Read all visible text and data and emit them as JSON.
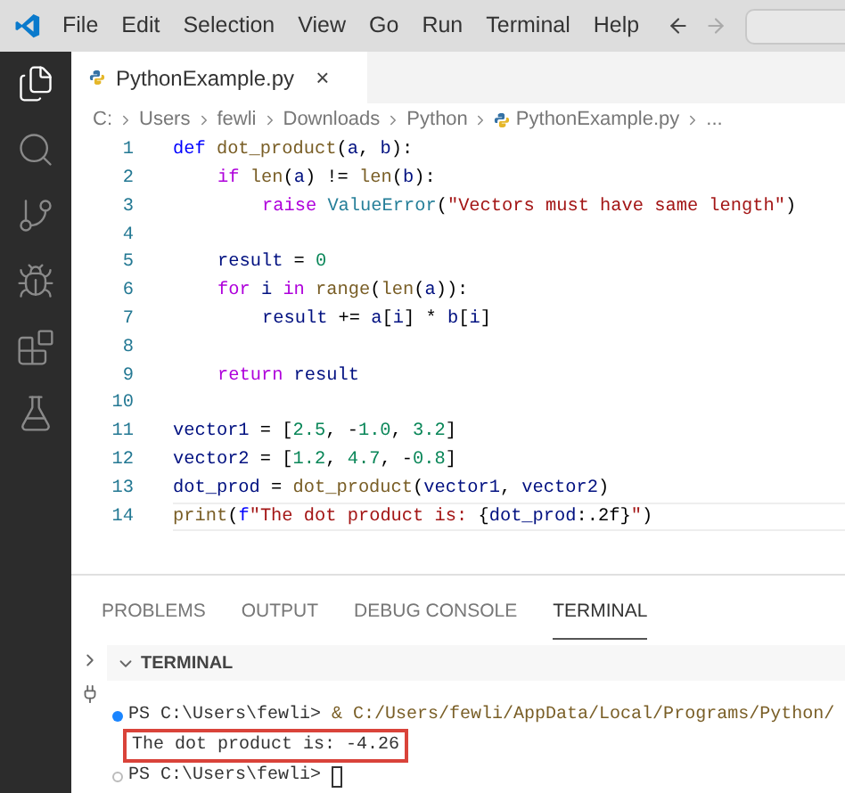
{
  "menu_bar": {
    "items": [
      "File",
      "Edit",
      "Selection",
      "View",
      "Go",
      "Run",
      "Terminal",
      "Help"
    ]
  },
  "activity_bar": {
    "items": [
      {
        "kind": "files",
        "selected": true
      },
      {
        "kind": "search",
        "selected": false
      },
      {
        "kind": "source-control",
        "selected": false
      },
      {
        "kind": "run-debug",
        "selected": false
      },
      {
        "kind": "extensions",
        "selected": false
      },
      {
        "kind": "testing",
        "selected": false
      }
    ]
  },
  "editor": {
    "tabs": [
      {
        "label": "PythonExample.py",
        "close": "×",
        "selected": true
      }
    ],
    "breadcrumb": [
      {
        "label": "C:",
        "kind": "folder"
      },
      {
        "label": "Users",
        "kind": "folder"
      },
      {
        "label": "fewli",
        "kind": "folder"
      },
      {
        "label": "Downloads",
        "kind": "folder"
      },
      {
        "label": "Python",
        "kind": "folder"
      },
      {
        "label": "PythonExample.py",
        "kind": "python-file"
      },
      {
        "label": "...",
        "kind": "symbols"
      }
    ],
    "lines": [
      {
        "number": "1",
        "tokens": [
          {
            "kind": "kw",
            "text": "def"
          },
          {
            "kind": "fn",
            "text": " dot_product"
          },
          {
            "kind": "plain",
            "text": "("
          },
          {
            "kind": "var",
            "text": "a"
          },
          {
            "kind": "plain",
            "text": ", "
          },
          {
            "kind": "var",
            "text": "b"
          },
          {
            "kind": "plain",
            "text": "):"
          }
        ],
        "children": [
          {
            "number": "2",
            "tokens": [
              {
                "kind": "ctl",
                "text": "if"
              },
              {
                "kind": "fn",
                "text": " len"
              },
              {
                "kind": "plain",
                "text": "("
              },
              {
                "kind": "var",
                "text": "a"
              },
              {
                "kind": "plain",
                "text": ") != "
              },
              {
                "kind": "fn",
                "text": "len"
              },
              {
                "kind": "plain",
                "text": "("
              },
              {
                "kind": "var",
                "text": "b"
              },
              {
                "kind": "plain",
                "text": "):"
              }
            ],
            "children": [
              {
                "number": "3",
                "tokens": [
                  {
                    "kind": "ctl",
                    "text": "raise"
                  },
                  {
                    "kind": "type",
                    "text": " ValueError"
                  },
                  {
                    "kind": "plain",
                    "text": "("
                  },
                  {
                    "kind": "str",
                    "text": "\"Vectors must have same length\""
                  },
                  {
                    "kind": "plain",
                    "text": ")"
                  }
                ]
              }
            ]
          },
          {
            "number": "4"
          },
          {
            "number": "5",
            "tokens": [
              {
                "kind": "var",
                "text": "result"
              },
              {
                "kind": "plain",
                "text": " = "
              },
              {
                "kind": "num",
                "text": "0"
              }
            ]
          },
          {
            "number": "6",
            "tokens": [
              {
                "kind": "ctl",
                "text": "for"
              },
              {
                "kind": "var",
                "text": " i"
              },
              {
                "kind": "ctl",
                "text": " in"
              },
              {
                "kind": "fn",
                "text": " range"
              },
              {
                "kind": "plain",
                "text": "("
              },
              {
                "kind": "fn",
                "text": "len"
              },
              {
                "kind": "plain",
                "text": "("
              },
              {
                "kind": "var",
                "text": "a"
              },
              {
                "kind": "plain",
                "text": ")):"
              }
            ],
            "children": [
              {
                "number": "7",
                "tokens": [
                  {
                    "kind": "var",
                    "text": "result"
                  },
                  {
                    "kind": "plain",
                    "text": " += "
                  },
                  {
                    "kind": "var",
                    "text": "a"
                  },
                  {
                    "kind": "plain",
                    "text": "["
                  },
                  {
                    "kind": "var",
                    "text": "i"
                  },
                  {
                    "kind": "plain",
                    "text": "] * "
                  },
                  {
                    "kind": "var",
                    "text": "b"
                  },
                  {
                    "kind": "plain",
                    "text": "["
                  },
                  {
                    "kind": "var",
                    "text": "i"
                  },
                  {
                    "kind": "plain",
                    "text": "]"
                  }
                ]
              }
            ]
          },
          {
            "number": "8"
          },
          {
            "number": "9",
            "tokens": [
              {
                "kind": "ctl",
                "text": "return"
              },
              {
                "kind": "var",
                "text": " result"
              }
            ]
          }
        ]
      },
      {
        "number": "10"
      },
      {
        "number": "11",
        "tokens": [
          {
            "kind": "var",
            "text": "vector1"
          },
          {
            "kind": "plain",
            "text": " = ["
          },
          {
            "kind": "num",
            "text": "2.5"
          },
          {
            "kind": "plain",
            "text": ", -"
          },
          {
            "kind": "num",
            "text": "1.0"
          },
          {
            "kind": "plain",
            "text": ", "
          },
          {
            "kind": "num",
            "text": "3.2"
          },
          {
            "kind": "plain",
            "text": "]"
          }
        ]
      },
      {
        "number": "12",
        "tokens": [
          {
            "kind": "var",
            "text": "vector2"
          },
          {
            "kind": "plain",
            "text": " = ["
          },
          {
            "kind": "num",
            "text": "1.2"
          },
          {
            "kind": "plain",
            "text": ", "
          },
          {
            "kind": "num",
            "text": "4.7"
          },
          {
            "kind": "plain",
            "text": ", -"
          },
          {
            "kind": "num",
            "text": "0.8"
          },
          {
            "kind": "plain",
            "text": "]"
          }
        ]
      },
      {
        "number": "13",
        "tokens": [
          {
            "kind": "var",
            "text": "dot_prod"
          },
          {
            "kind": "plain",
            "text": " = "
          },
          {
            "kind": "fn",
            "text": "dot_product"
          },
          {
            "kind": "plain",
            "text": "("
          },
          {
            "kind": "var",
            "text": "vector1"
          },
          {
            "kind": "plain",
            "text": ", "
          },
          {
            "kind": "var",
            "text": "vector2"
          },
          {
            "kind": "plain",
            "text": ")"
          }
        ]
      },
      {
        "number": "14",
        "tokens": [
          {
            "kind": "fn",
            "text": "print"
          },
          {
            "kind": "plain",
            "text": "("
          },
          {
            "kind": "kw",
            "text": "f"
          },
          {
            "kind": "str",
            "text": "\"The dot product is: "
          },
          {
            "kind": "plain",
            "text": "{"
          },
          {
            "kind": "var",
            "text": "dot_prod"
          },
          {
            "kind": "plain",
            "text": ":.2f}"
          },
          {
            "kind": "str",
            "text": "\""
          },
          {
            "kind": "plain",
            "text": ")"
          }
        ]
      }
    ]
  },
  "panel": {
    "tabs": [
      {
        "label": "PROBLEMS",
        "selected": false
      },
      {
        "label": "OUTPUT",
        "selected": false
      },
      {
        "label": "DEBUG CONSOLE",
        "selected": false
      },
      {
        "label": "TERMINAL",
        "selected": true
      }
    ],
    "terminal": {
      "title": "TERMINAL",
      "expanded": true,
      "lines": [
        {
          "kind": "command",
          "success": true,
          "prompt": "PS C:\\Users\\fewli>",
          "command": "& C:/Users/fewli/AppData/Local/Programs/Python/"
        },
        {
          "kind": "output",
          "highlighted": true,
          "text": "The dot product is: -4.26"
        },
        {
          "kind": "command",
          "success": false,
          "prompt": "PS C:\\Users\\fewli>"
        }
      ]
    }
  }
}
